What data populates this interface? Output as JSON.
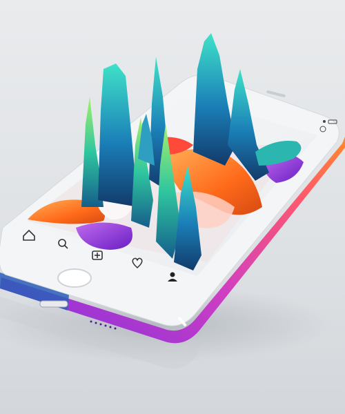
{
  "image": {
    "subject": "phone-with-3d-paint-art",
    "colors": {
      "background": "#e4e7ea",
      "phone_body_white": "#f4f5f6",
      "phone_edge_orange": "#ff7a2a",
      "phone_edge_magenta": "#c43bd4",
      "phone_edge_purple": "#8a2be2",
      "paint_teal": "#2ec7c0",
      "paint_blue": "#1f6fb2",
      "paint_green": "#6bd36b",
      "paint_orange": "#ff7a1a",
      "paint_purple": "#9b3de0"
    }
  },
  "phone": {
    "tab_bar": {
      "items": [
        {
          "name": "home-icon",
          "glyph": "⌂"
        },
        {
          "name": "search-icon",
          "glyph": "⌕"
        },
        {
          "name": "add-post-icon",
          "glyph": "+"
        },
        {
          "name": "heart-icon",
          "glyph": "♡"
        },
        {
          "name": "profile-icon",
          "glyph": "●"
        }
      ]
    }
  }
}
